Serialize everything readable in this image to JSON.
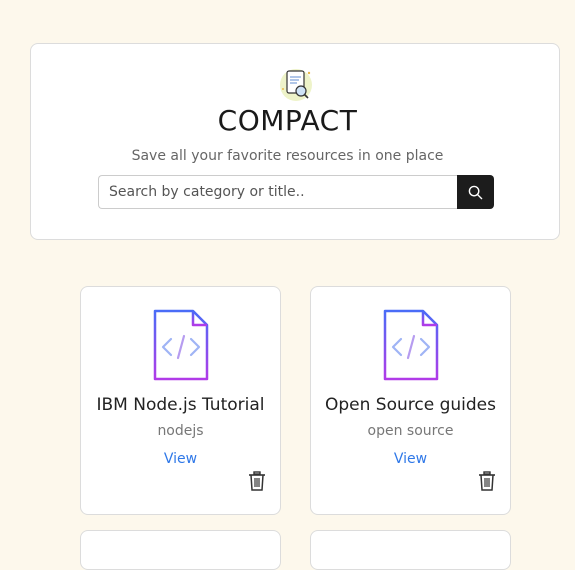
{
  "header": {
    "title": "COMPACT",
    "subtitle": "Save all your favorite resources in one place",
    "logo_icon": "document-search-icon"
  },
  "search": {
    "placeholder": "Search by category or title..",
    "value": "",
    "button_icon": "search-icon"
  },
  "resources": [
    {
      "title": "IBM Node.js Tutorial",
      "category": "nodejs",
      "link_label": "View"
    },
    {
      "title": "Open Source guides",
      "category": "open source",
      "link_label": "View"
    }
  ],
  "colors": {
    "background": "#fdf8ec",
    "link": "#2f78e8",
    "icon_gradient_top": "#4a6cf7",
    "icon_gradient_bottom": "#b13be8"
  }
}
